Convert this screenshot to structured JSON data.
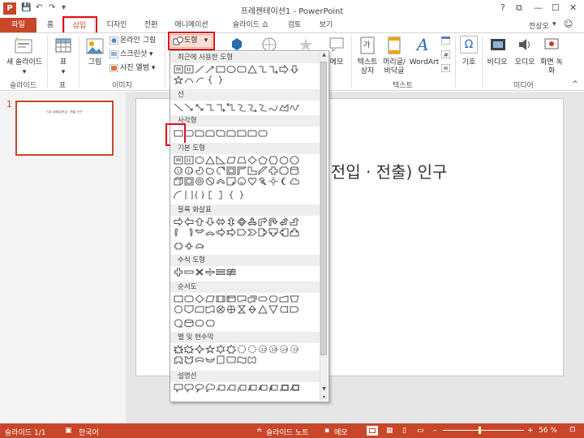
{
  "window": {
    "title": "프레젠테이션1 - PowerPoint",
    "controls": [
      "?",
      "⧉",
      "—",
      "☐",
      "✕"
    ]
  },
  "qat": {
    "save": "💾",
    "undo": "↶",
    "redo": "↷",
    "customize": "▾"
  },
  "tabs": [
    {
      "label": "파일"
    },
    {
      "label": "홈"
    },
    {
      "label": "삽입"
    },
    {
      "label": "디자인"
    },
    {
      "label": "전환"
    },
    {
      "label": "애니메이션"
    },
    {
      "label": "슬라이드 쇼"
    },
    {
      "label": "검토"
    },
    {
      "label": "보기"
    }
  ],
  "account": {
    "name": "전상오",
    "chevron": "▾",
    "smiley": "☺"
  },
  "ribbon": {
    "new_slide": "새 슬라이드",
    "table": "표",
    "picture": "그림",
    "online_picture": "온라인 그림",
    "screenshot": "스크린샷 ▾",
    "photo_album": "사진 앨범 ▾",
    "shapes": "도형",
    "memo": "메모",
    "textbox": "텍스트 상자",
    "header_footer": "머리글/ 바닥글",
    "wordart": "WordArt",
    "symbol": "기호",
    "video": "비디오",
    "audio": "오디오",
    "screen_record": "화면 녹화",
    "groups": {
      "slides": "슬라이드",
      "tables": "표",
      "images": "이미지",
      "text": "텍스트",
      "media": "미디어"
    }
  },
  "shapes_menu": {
    "sections": [
      "최근에 사용한 도형",
      "선",
      "사각형",
      "기본 도형",
      "블록 화살표",
      "수식 도형",
      "순서도",
      "별 및 현수막",
      "설명선"
    ]
  },
  "thumbnail": {
    "number": "1",
    "text": "지주 승패입(전입 · 전출) 인구"
  },
  "slide": {
    "title_visible": "(전입 · 전출) 인구"
  },
  "status": {
    "slide_info": "슬라이드 1/1",
    "language": "한국어",
    "notes": "슬라이드 노트",
    "comments": "메모",
    "zoom": "56 %"
  },
  "colors": {
    "accent": "#c8462a",
    "highlight": "#e0101a"
  }
}
